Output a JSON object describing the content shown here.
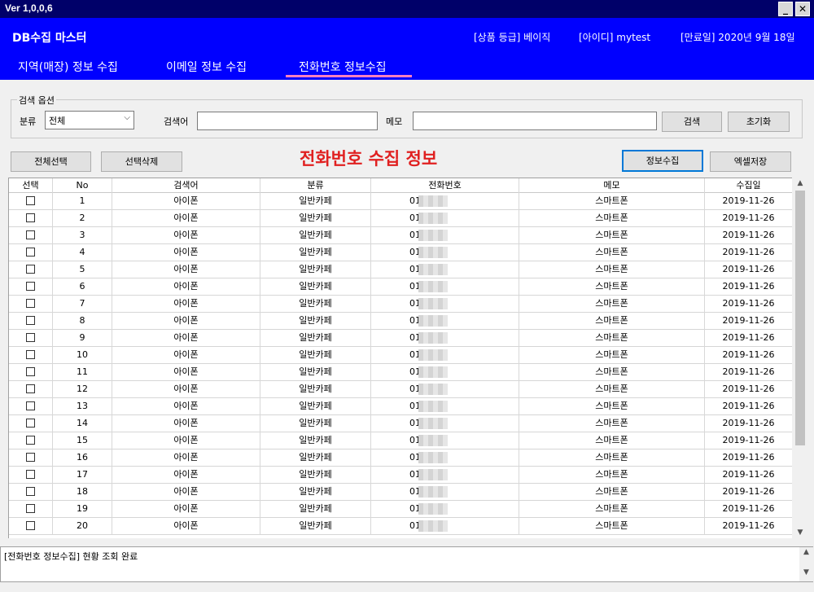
{
  "window": {
    "version": "Ver 1,0,0,6",
    "minimize": "_",
    "close": "✕"
  },
  "header": {
    "title": "DB수집 마스터",
    "grade": "[상품 등급] 베이직",
    "user_id": "[아이디] mytest",
    "expire": "[만료일]  2020년 9월 18일"
  },
  "tabs": [
    {
      "label": "지역(매장) 정보 수집"
    },
    {
      "label": "이메일 정보 수집"
    },
    {
      "label": "전화번호 정보수집",
      "active": true
    }
  ],
  "colors": {
    "accent": "#0000ff",
    "titlebar": "#000069",
    "title_red": "#e02020",
    "tab_underline": "#ff80c0"
  },
  "search": {
    "group_label": "검색 옵션",
    "category_label": "분류",
    "category_value": "전체",
    "keyword_label": "검색어",
    "keyword_value": "",
    "memo_label": "메모",
    "memo_value": "",
    "search_button": "검색",
    "reset_button": "초기화"
  },
  "toolbar": {
    "select_all": "전체선택",
    "delete_selected": "선택삭제",
    "list_title": "전화번호 수집 정보",
    "collect": "정보수집",
    "excel_save": "엑셀저장"
  },
  "table": {
    "columns": [
      "선택",
      "No",
      "검색어",
      "분류",
      "전화번호",
      "메모",
      "수집일"
    ],
    "rows": [
      {
        "no": "1",
        "keyword": "아이폰",
        "category": "일반카페",
        "phone": "010-",
        "memo": "스마트폰",
        "date": "2019-11-26"
      },
      {
        "no": "2",
        "keyword": "아이폰",
        "category": "일반카페",
        "phone": "010-",
        "memo": "스마트폰",
        "date": "2019-11-26"
      },
      {
        "no": "3",
        "keyword": "아이폰",
        "category": "일반카페",
        "phone": "010-",
        "memo": "스마트폰",
        "date": "2019-11-26"
      },
      {
        "no": "4",
        "keyword": "아이폰",
        "category": "일반카페",
        "phone": "010-",
        "memo": "스마트폰",
        "date": "2019-11-26"
      },
      {
        "no": "5",
        "keyword": "아이폰",
        "category": "일반카페",
        "phone": "010-",
        "memo": "스마트폰",
        "date": "2019-11-26"
      },
      {
        "no": "6",
        "keyword": "아이폰",
        "category": "일반카페",
        "phone": "010-",
        "memo": "스마트폰",
        "date": "2019-11-26"
      },
      {
        "no": "7",
        "keyword": "아이폰",
        "category": "일반카페",
        "phone": "010-",
        "memo": "스마트폰",
        "date": "2019-11-26"
      },
      {
        "no": "8",
        "keyword": "아이폰",
        "category": "일반카페",
        "phone": "010-",
        "memo": "스마트폰",
        "date": "2019-11-26"
      },
      {
        "no": "9",
        "keyword": "아이폰",
        "category": "일반카페",
        "phone": "010-",
        "memo": "스마트폰",
        "date": "2019-11-26"
      },
      {
        "no": "10",
        "keyword": "아이폰",
        "category": "일반카페",
        "phone": "010-",
        "memo": "스마트폰",
        "date": "2019-11-26"
      },
      {
        "no": "11",
        "keyword": "아이폰",
        "category": "일반카페",
        "phone": "010-",
        "memo": "스마트폰",
        "date": "2019-11-26"
      },
      {
        "no": "12",
        "keyword": "아이폰",
        "category": "일반카페",
        "phone": "010-",
        "memo": "스마트폰",
        "date": "2019-11-26"
      },
      {
        "no": "13",
        "keyword": "아이폰",
        "category": "일반카페",
        "phone": "010-",
        "memo": "스마트폰",
        "date": "2019-11-26"
      },
      {
        "no": "14",
        "keyword": "아이폰",
        "category": "일반카페",
        "phone": "010-",
        "memo": "스마트폰",
        "date": "2019-11-26"
      },
      {
        "no": "15",
        "keyword": "아이폰",
        "category": "일반카페",
        "phone": "010-",
        "memo": "스마트폰",
        "date": "2019-11-26"
      },
      {
        "no": "16",
        "keyword": "아이폰",
        "category": "일반카페",
        "phone": "010-",
        "memo": "스마트폰",
        "date": "2019-11-26"
      },
      {
        "no": "17",
        "keyword": "아이폰",
        "category": "일반카페",
        "phone": "010-",
        "memo": "스마트폰",
        "date": "2019-11-26"
      },
      {
        "no": "18",
        "keyword": "아이폰",
        "category": "일반카페",
        "phone": "010-",
        "memo": "스마트폰",
        "date": "2019-11-26"
      },
      {
        "no": "19",
        "keyword": "아이폰",
        "category": "일반카페",
        "phone": "010-",
        "memo": "스마트폰",
        "date": "2019-11-26"
      },
      {
        "no": "20",
        "keyword": "아이폰",
        "category": "일반카페",
        "phone": "010-",
        "memo": "스마트폰",
        "date": "2019-11-26"
      }
    ]
  },
  "log": {
    "text": "[전화번호 정보수집] 현황 조회 완료"
  }
}
